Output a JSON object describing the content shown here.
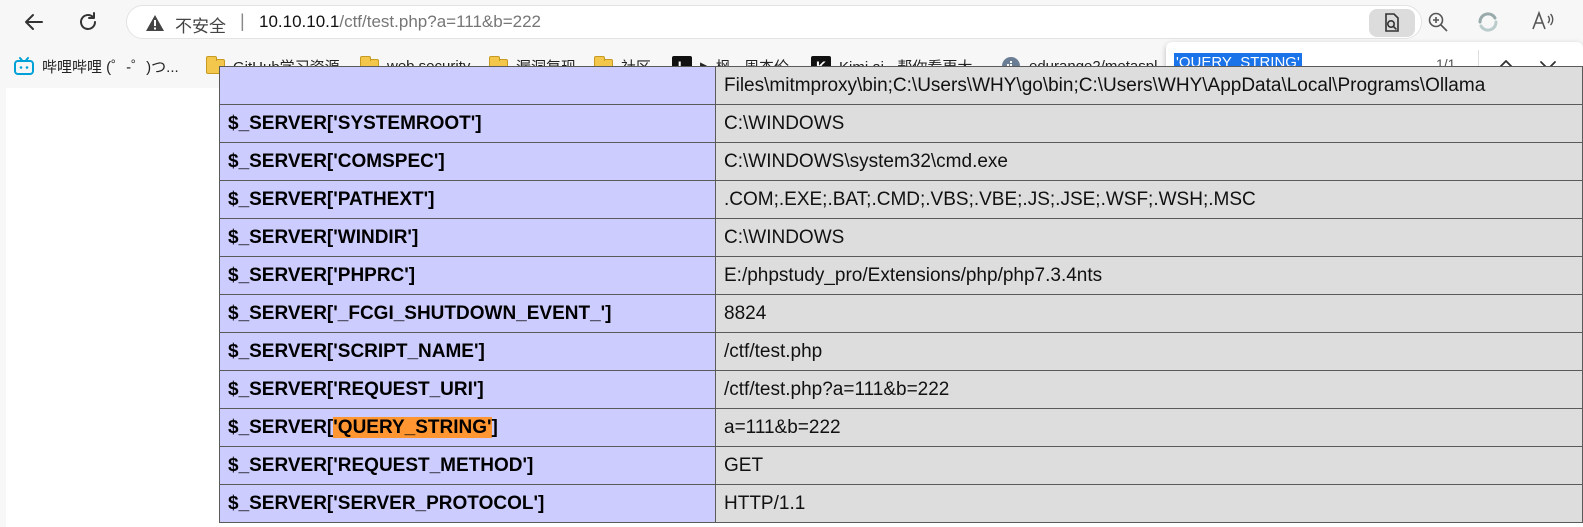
{
  "browser": {
    "address": {
      "security_label": "不安全",
      "separator": "|",
      "url_host": "10.10.10.1",
      "url_path": "/ctf/test.php?a=111&b=222"
    }
  },
  "bookmarks": [
    {
      "label": "哔哩哔哩 (゜-゜)つ...",
      "icon": "bilibili-icon"
    },
    {
      "label": "GitHub学习资源",
      "icon": "folder-icon"
    },
    {
      "label": "web security",
      "icon": "folder-icon"
    },
    {
      "label": "漏洞复现",
      "icon": "folder-icon"
    },
    {
      "label": "社区",
      "icon": "folder-icon"
    },
    {
      "label": "▶ 枫 - 周杰伦",
      "icon": "l-logo-icon",
      "logo_letter": "L"
    },
    {
      "label": "Kimi.ai - 帮你看更大...",
      "icon": "k-logo-icon",
      "logo_letter": "K"
    },
    {
      "label": "edurange2/metaspl...",
      "icon": "docker-icon"
    }
  ],
  "find": {
    "query": "'QUERY_STRING'",
    "count": "1/1"
  },
  "server_table": {
    "partial_first_value": "Files\\mitmproxy\\bin;C:\\Users\\WHY\\go\\bin;C:\\Users\\WHY\\AppData\\Local\\Programs\\Ollama",
    "rows": [
      {
        "key": "$_SERVER['SYSTEMROOT']",
        "value": "C:\\WINDOWS"
      },
      {
        "key": "$_SERVER['COMSPEC']",
        "value": "C:\\WINDOWS\\system32\\cmd.exe"
      },
      {
        "key": "$_SERVER['PATHEXT']",
        "value": ".COM;.EXE;.BAT;.CMD;.VBS;.VBE;.JS;.JSE;.WSF;.WSH;.MSC"
      },
      {
        "key": "$_SERVER['WINDIR']",
        "value": "C:\\WINDOWS"
      },
      {
        "key": "$_SERVER['PHPRC']",
        "value": "E:/phpstudy_pro/Extensions/php/php7.3.4nts"
      },
      {
        "key": "$_SERVER['_FCGI_SHUTDOWN_EVENT_']",
        "value": "8824"
      },
      {
        "key": "$_SERVER['SCRIPT_NAME']",
        "value": "/ctf/test.php"
      },
      {
        "key": "$_SERVER['REQUEST_URI']",
        "value": "/ctf/test.php?a=111&b=222"
      },
      {
        "key_prefix": "$_SERVER[",
        "key_highlight": "'QUERY_STRING'",
        "key_suffix": "]",
        "value": "a=111&b=222"
      },
      {
        "key": "$_SERVER['REQUEST_METHOD']",
        "value": "GET"
      },
      {
        "key": "$_SERVER['SERVER_PROTOCOL']",
        "value": "HTTP/1.1"
      }
    ]
  },
  "colors": {
    "key_cell_bg": "#ccccff",
    "value_cell_bg": "#dddddd",
    "find_highlight": "#ff9632",
    "find_selection": "#1a73e8"
  }
}
